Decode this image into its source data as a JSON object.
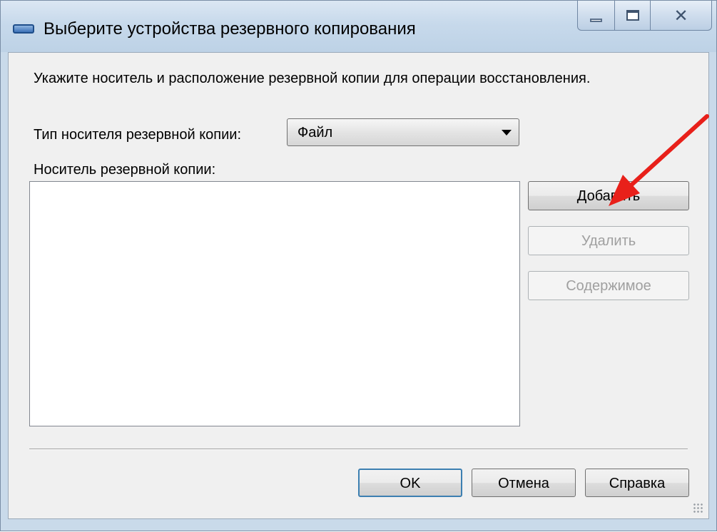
{
  "window": {
    "title": "Выберите устройства резервного копирования"
  },
  "dialog": {
    "instruction": "Укажите носитель и расположение резервной копии для операции восстановления.",
    "media_type_label": "Тип носителя резервной копии:",
    "media_type_value": "Файл",
    "media_label": "Носитель резервной копии:"
  },
  "side_buttons": {
    "add": "Добавить",
    "remove": "Удалить",
    "contents": "Содержимое"
  },
  "footer": {
    "ok": "OK",
    "cancel": "Отмена",
    "help": "Справка"
  },
  "colors": {
    "annotation_arrow": "#e8201a",
    "default_button_border": "#3c7fb1"
  }
}
